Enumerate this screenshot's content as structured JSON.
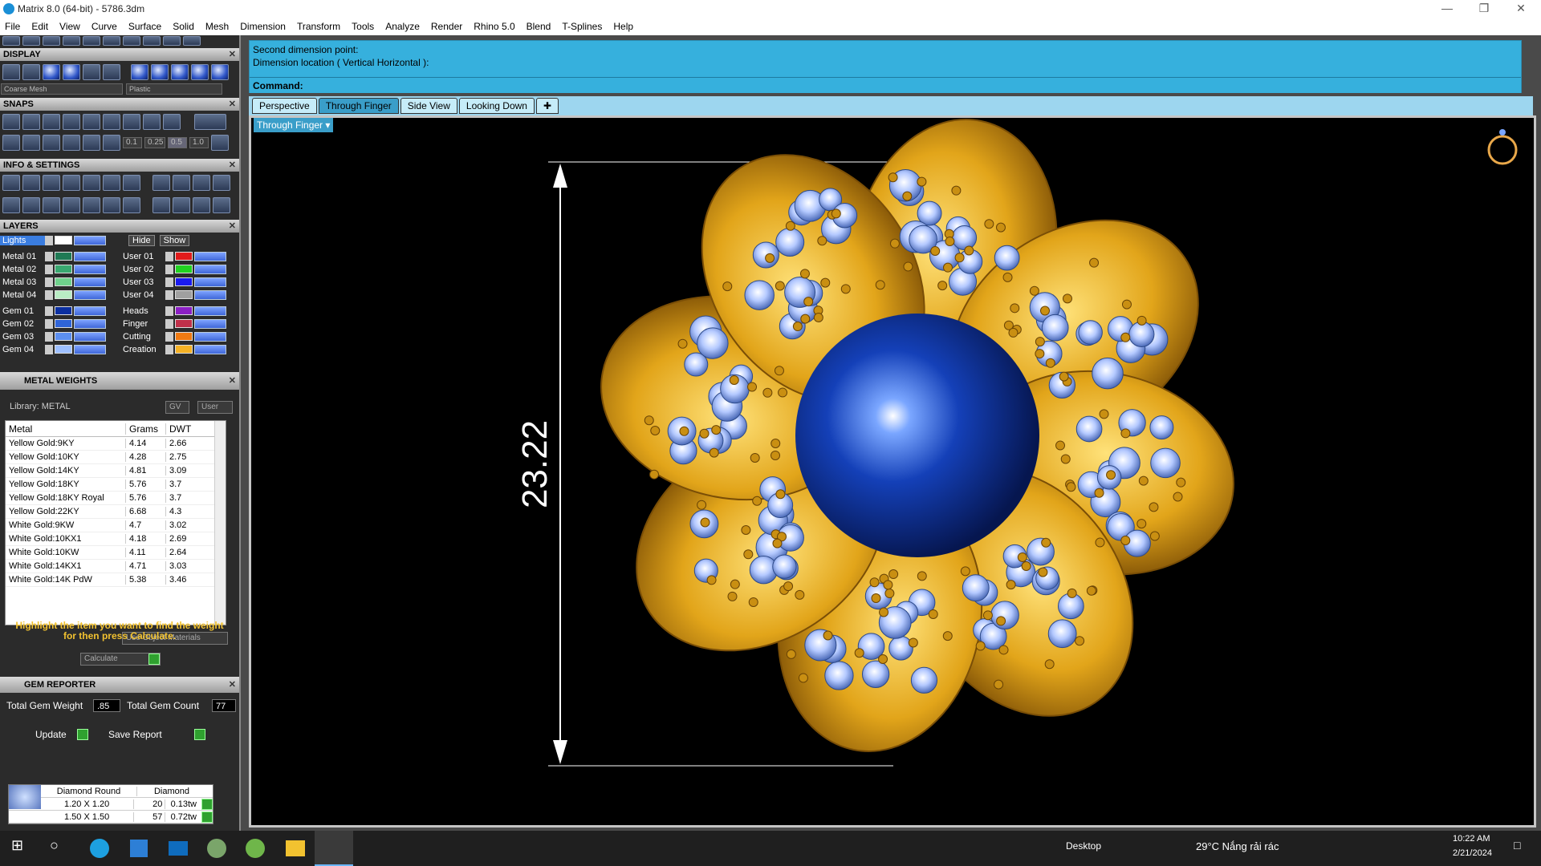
{
  "window": {
    "title": "Matrix 8.0 (64-bit) - 5786.3dm"
  },
  "menu": [
    "File",
    "Edit",
    "View",
    "Curve",
    "Surface",
    "Solid",
    "Mesh",
    "Dimension",
    "Transform",
    "Tools",
    "Analyze",
    "Render",
    "Rhino 5.0",
    "Blend",
    "T-Splines",
    "Help"
  ],
  "display": {
    "title": "DISPLAY",
    "mesh_select": "Coarse Mesh",
    "material_select": "Plastic"
  },
  "snaps": {
    "title": "SNAPS",
    "values": [
      "0.1",
      "0.25",
      "0.5",
      "1.0"
    ]
  },
  "info": {
    "title": "INFO & SETTINGS"
  },
  "layers": {
    "title": "LAYERS",
    "lights": "Lights",
    "hide": "Hide",
    "show": "Show",
    "left": [
      {
        "name": "Metal 01",
        "color": "#1f7a55"
      },
      {
        "name": "Metal 02",
        "color": "#39a870"
      },
      {
        "name": "Metal 03",
        "color": "#6fd18c"
      },
      {
        "name": "Metal 04",
        "color": "#b9ecc4"
      },
      {
        "name": "Gem 01",
        "color": "#0b2fa0"
      },
      {
        "name": "Gem 02",
        "color": "#2f64d8"
      },
      {
        "name": "Gem 03",
        "color": "#5c8ff0"
      },
      {
        "name": "Gem 04",
        "color": "#9ec0ff"
      }
    ],
    "right": [
      {
        "name": "User 01",
        "color": "#e11b1b"
      },
      {
        "name": "User 02",
        "color": "#21d321"
      },
      {
        "name": "User 03",
        "color": "#1a1af0"
      },
      {
        "name": "User 04",
        "color": "#a0a0a0"
      },
      {
        "name": "Heads",
        "color": "#8b1fc4"
      },
      {
        "name": "Finger",
        "color": "#c0304a"
      },
      {
        "name": "Cutting",
        "color": "#f07a12"
      },
      {
        "name": "Creation",
        "color": "#f5b225"
      }
    ]
  },
  "metal_weights": {
    "title": "METAL WEIGHTS",
    "library": "Library: METAL",
    "gv": "GV",
    "user": "User",
    "columns": [
      "Metal",
      "Grams",
      "DWT"
    ],
    "rows": [
      [
        "Yellow Gold:9KY",
        "4.14",
        "2.66"
      ],
      [
        "Yellow Gold:10KY",
        "4.28",
        "2.75"
      ],
      [
        "Yellow Gold:14KY",
        "4.81",
        "3.09"
      ],
      [
        "Yellow Gold:18KY",
        "5.76",
        "3.7"
      ],
      [
        "Yellow Gold:18KY Royal",
        "5.76",
        "3.7"
      ],
      [
        "Yellow Gold:22KY",
        "6.68",
        "4.3"
      ],
      [
        "White Gold:9KW",
        "4.7",
        "3.02"
      ],
      [
        "White Gold:10KX1",
        "4.18",
        "2.69"
      ],
      [
        "White Gold:10KW",
        "4.11",
        "2.64"
      ],
      [
        "White Gold:14KX1",
        "4.71",
        "3.03"
      ],
      [
        "White Gold:14K PdW",
        "5.38",
        "3.46"
      ]
    ],
    "use_object_materials": "Use Object Materials",
    "hint_line1": "Highlight the item you want to find the weight",
    "hint_line2": "for then press Calculate.",
    "calculate": "Calculate"
  },
  "gem_reporter": {
    "title": "GEM REPORTER",
    "total_weight_label": "Total Gem Weight",
    "total_weight": ".85",
    "total_count_label": "Total Gem Count",
    "total_count": "77",
    "update": "Update",
    "save_report": "Save Report",
    "header": [
      "Diamond Round",
      "Diamond"
    ],
    "rows": [
      [
        "1.20 X 1.20",
        "20",
        "0.13tw"
      ],
      [
        "1.50 X 1.50",
        "57",
        "0.72tw"
      ]
    ]
  },
  "command": {
    "line1": "Second dimension point:",
    "line2": "Dimension location ( Vertical  Horizontal ):",
    "prompt": "Command:"
  },
  "view_tabs": [
    "Perspective",
    "Through Finger",
    "Side View",
    "Looking Down"
  ],
  "active_tab": "Through Finger",
  "viewport": {
    "label": "Through Finger",
    "dimension": "23.22"
  },
  "taskbar": {
    "desktop": "Desktop",
    "weather": "29°C  Nắng rải rác",
    "time": "10:22 AM",
    "date": "2/21/2024"
  },
  "colors": {
    "gold": "#e2a51a",
    "pearl": "#0d2f9c",
    "command_bg": "#36b0dd"
  }
}
